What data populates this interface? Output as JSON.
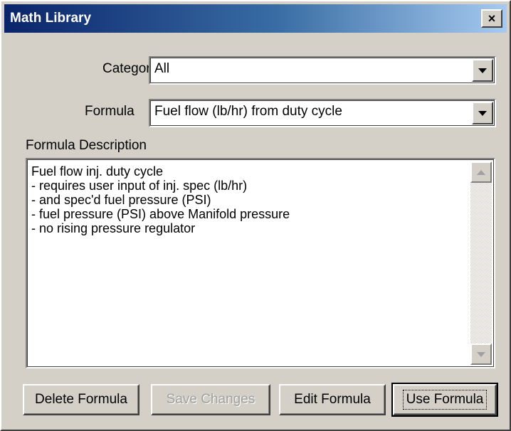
{
  "window": {
    "title": "Math Library",
    "close_symbol": "×"
  },
  "category": {
    "label": "Category",
    "value": "All"
  },
  "formula": {
    "label": "Formula",
    "value": "Fuel flow (lb/hr) from duty cycle"
  },
  "description": {
    "label": "Formula Description",
    "lines": [
      "Fuel flow inj. duty cycle",
      "",
      "- requires user input of inj. spec (lb/hr)",
      "- and spec'd fuel pressure (PSI)",
      "- fuel pressure (PSI) above Manifold pressure",
      "- no rising pressure regulator"
    ]
  },
  "buttons": {
    "delete": "Delete Formula",
    "save": "Save Changes",
    "edit": "Edit Formula",
    "use": "Use Formula"
  },
  "icons": {
    "close": "close-icon",
    "dropdown": "chevron-down-icon",
    "scroll_up": "scroll-up-arrow-icon",
    "scroll_down": "scroll-down-arrow-icon"
  },
  "colors": {
    "titlebar_start": "#0a246a",
    "titlebar_end": "#a6caf0",
    "face": "#d4d0c8"
  }
}
